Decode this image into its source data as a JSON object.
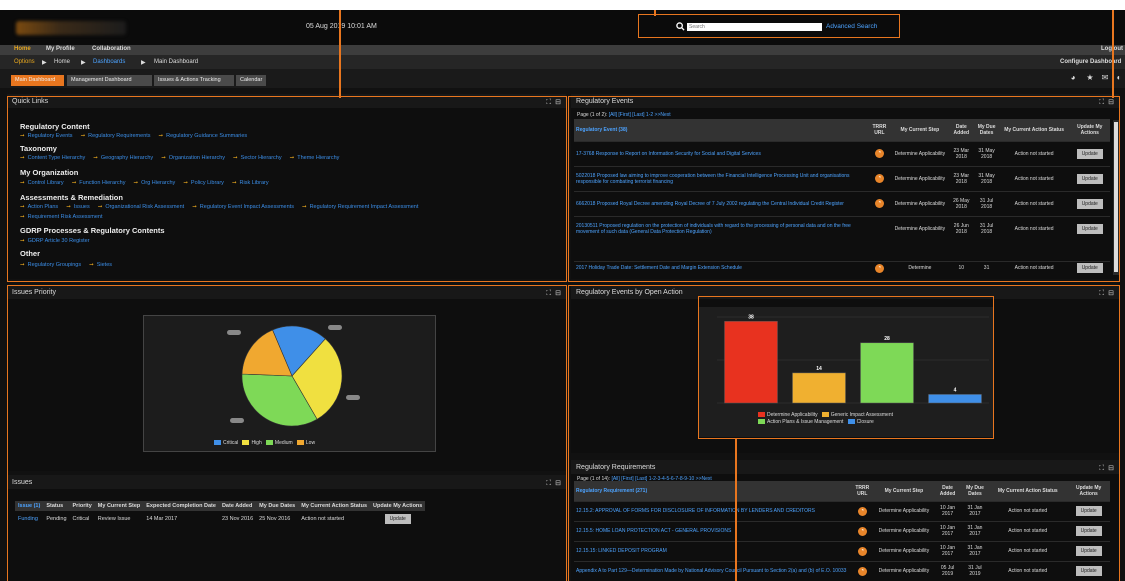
{
  "header": {
    "datetime": "05 Aug 2019 10:01 AM",
    "search_placeholder": "Search",
    "advanced_search": "Advanced Search"
  },
  "nav": {
    "home": "Home",
    "my_profile": "My Profile",
    "collaboration": "Collaboration",
    "logout": "Log out"
  },
  "breadcrumb": {
    "options": "Options",
    "home": "Home",
    "dashboards": "Dashboards",
    "main_dashboard": "Main Dashboard",
    "configure": "Configure Dashboard"
  },
  "tabs": [
    "Main Dashboard",
    "Management Dashboard",
    "Issues & Actions Tracking",
    "Calendar"
  ],
  "quick_links": {
    "title": "Quick Links",
    "controls": "⛶ ⊟",
    "sections": [
      {
        "heading": "Regulatory Content",
        "links": [
          "Regulatory Events",
          "Regulatory Requirements",
          "Regulatory Guidance Summaries"
        ]
      },
      {
        "heading": "Taxonomy",
        "links": [
          "Content Type Hierarchy",
          "Geography Hierarchy",
          "Organization Hierarchy",
          "Sector Hierarchy",
          "Theme Hierarchy"
        ]
      },
      {
        "heading": "My Organization",
        "links": [
          "Control Library",
          "Function Hierarchy",
          "Org Hierarchy",
          "Policy Library",
          "Risk Library"
        ]
      },
      {
        "heading": "Assessments & Remediation",
        "links": [
          "Action Plans",
          "Issues",
          "Organizational Risk Assessment",
          "Regulatory Event Impact Assessments",
          "Regulatory Requirement Impact Assessment"
        ],
        "links2": [
          "Requirement Risk Assessment"
        ]
      },
      {
        "heading": "GDRP Processes & Regulatory Contents",
        "links": [
          "GDRP Article 30 Register"
        ]
      },
      {
        "heading": "Other",
        "links": [
          "Regulatory Groupings",
          "Sietes"
        ]
      }
    ]
  },
  "regulatory_events": {
    "title": "Regulatory Events",
    "pager": "Page (1 of 2):",
    "pager_links": "[All] [First] [Last] 1-2 >>Next",
    "columns": [
      "Regulatory Event (38)",
      "TRRR URL",
      "My Current Step",
      "Date Added",
      "My Due Dates",
      "My Current Action Status",
      "Update My Actions"
    ],
    "rows": [
      {
        "title": "17-3768 Response to Report on Information Security for Social and Digital Services",
        "step": "Determine Applicability",
        "date": "23 Mar 2018",
        "due": "31 May 2018",
        "status": "Action not started",
        "action": "Update"
      },
      {
        "title": "5022018 Proposed law aiming to improve cooperation between the Financial Intelligence Processing Unit and organisations responsible for combating terrorist financing",
        "step": "Determine Applicability",
        "date": "23 Mar 2018",
        "due": "31 May 2018",
        "status": "Action not started",
        "action": "Update"
      },
      {
        "title": "6662018 Proposed Royal Decree amending Royal Decree of 7 July 2002 regulating the Central Individual Credit Register",
        "step": "Determine Applicability",
        "date": "26 May 2018",
        "due": "31 Jul 2018",
        "status": "Action not started",
        "action": "Update"
      },
      {
        "title": "20130511 Proposed regulation on the protection of individuals with regard to the processing of personal data and on the free movement of such data (General Data Protection Regulation)",
        "step": "Determine Applicability",
        "date": "26 Jun 2018",
        "due": "31 Jul 2018",
        "status": "Action not started",
        "action": "Update"
      },
      {
        "title": "2017 Holiday Trade Date: Settlement Date and Margin Extension Schedule",
        "step": "Determine",
        "date": "10",
        "due": "31",
        "status": "Action not started",
        "action": "Update"
      }
    ]
  },
  "issues_priority": {
    "title": "Issues Priority",
    "legend": [
      "Critical",
      "High",
      "Medium",
      "Low"
    ]
  },
  "issues": {
    "title": "Issues",
    "columns": [
      "Issue (1)",
      "Status",
      "Priority",
      "My Current Step",
      "Expected Completion Date",
      "Date Added",
      "My Due Dates",
      "My Current Action Status",
      "Update My Actions"
    ],
    "rows": [
      {
        "issue": "Funding",
        "status": "Pending",
        "priority": "Critical",
        "step": "Review Issue",
        "expected": "14 Mar 2017",
        "added": "23 Nov 2016",
        "due": "25 Nov 2016",
        "action_status": "Action not started",
        "action": "Update"
      }
    ]
  },
  "events_by_action": {
    "title": "Regulatory Events by Open Action",
    "legend": [
      "Determine Applicability",
      "Generic Impact Assessment",
      "Action Plans & Issue Management",
      "Closure"
    ]
  },
  "regulatory_requirements": {
    "title": "Regulatory Requirements",
    "pager": "Page (1 of 14):",
    "pager_links": "[All] [First] [Last] 1-2-3-4-5-6-7-8-9-10 >>Next",
    "columns": [
      "Regulatory Requirement (271)",
      "TRRR URL",
      "My Current Step",
      "Date Added",
      "My Due Dates",
      "My Current Action Status",
      "Update My Actions"
    ],
    "rows": [
      {
        "title": "12.15.2: APPROVAL OF FORMS FOR DISCLOSURE OF INFORMATION BY LENDERS AND CREDITORS",
        "step": "Determine Applicability",
        "date": "10 Jan 2017",
        "due": "31 Jan 2017",
        "status": "Action not started",
        "action": "Update"
      },
      {
        "title": "12.15.5: HOME LOAN PROTECTION ACT - GENERAL PROVISIONS",
        "step": "Determine Applicability",
        "date": "10 Jan 2017",
        "due": "31 Jan 2017",
        "status": "Action not started",
        "action": "Update"
      },
      {
        "title": "12.15.15: LINKED DEPOSIT PROGRAM",
        "step": "Determine Applicability",
        "date": "10 Jan 2017",
        "due": "31 Jan 2017",
        "status": "Action not started",
        "action": "Update"
      },
      {
        "title": "Appendix A to Part 129—Determination Made by National Advisory Council Pursuant to Section 2(a) and (b) of E.O. 10033",
        "step": "Determine Applicability",
        "date": "05 Jul 2019",
        "due": "31 Jul 2019",
        "status": "Action not started",
        "action": "Update"
      }
    ]
  },
  "colors": {
    "accent": "#e8761f",
    "link": "#4da3ff",
    "critical": "#3f8fe8",
    "high": "#f0e040",
    "medium": "#7ed957",
    "low": "#f0a830"
  },
  "chart_data": [
    {
      "type": "pie",
      "title": "Issues Priority",
      "labels": [
        "Critical",
        "High",
        "Medium",
        "Low"
      ],
      "values": [
        18,
        30,
        34,
        18
      ],
      "colors": [
        "#3f8fe8",
        "#f0e040",
        "#7ed957",
        "#f0a830"
      ],
      "legend": "bottom"
    },
    {
      "type": "bar",
      "title": "Regulatory Events by Open Action",
      "categories": [
        "Determine Applicability",
        "Generic Impact Assessment",
        "Action Plans & Issue Management",
        "Closure"
      ],
      "values": [
        38,
        14,
        28,
        4
      ],
      "colors": [
        "#e8321f",
        "#f0b030",
        "#7ed957",
        "#3f8fe8"
      ],
      "ylim": [
        0,
        40
      ],
      "legend": "bottom"
    }
  ]
}
